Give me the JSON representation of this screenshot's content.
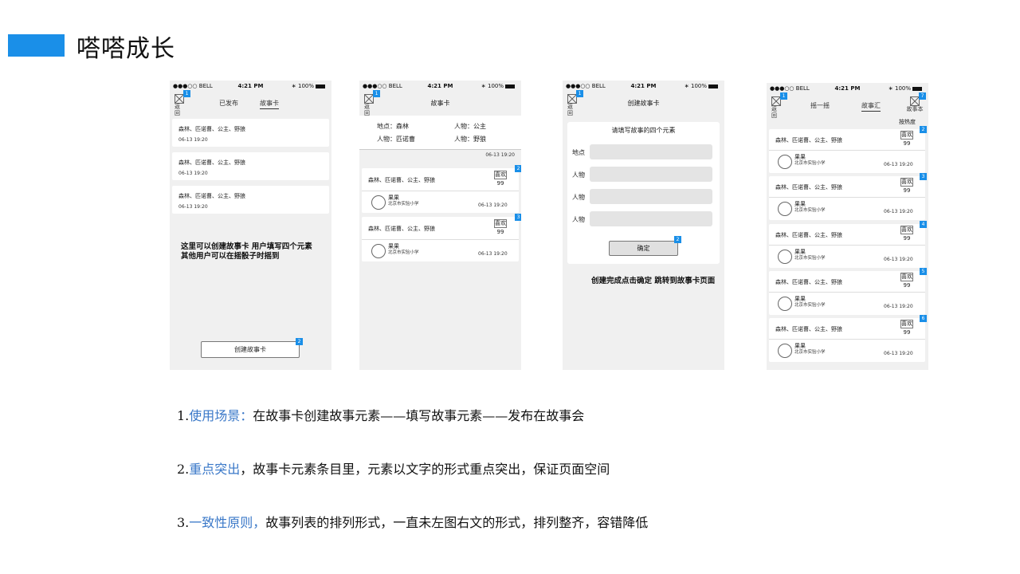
{
  "slide": {
    "title": "嗒嗒成长"
  },
  "status_bar": {
    "carrier": "●●●○○ BELL",
    "time": "4:21 PM",
    "battery": "100%"
  },
  "phone1": {
    "back_label": "返回",
    "badge_back": "1",
    "tabs": [
      "已发布",
      "故事卡"
    ],
    "cards": [
      {
        "elements": "森林、匹诺曹、公主、野狼",
        "time": "06-13  19:20"
      },
      {
        "elements": "森林、匹诺曹、公主、野狼",
        "time": "06-13  19:20"
      },
      {
        "elements": "森林、匹诺曹、公主、野狼",
        "time": "06-13  19:20"
      }
    ],
    "note_line1": "这里可以创建故事卡  用户填写四个元素",
    "note_line2": "其他用户可以在摇骰子时摇到",
    "create_button": "创建故事卡",
    "badge_create": "2"
  },
  "phone2": {
    "back_label": "返回",
    "badge_back": "1",
    "title": "故事卡",
    "detail": {
      "place": "地点：森林",
      "person1": "人物：公主",
      "person2": "人物：匹诺曹",
      "person3": "人物：野狼",
      "time": "06-13  19:20"
    },
    "posts": [
      {
        "badge": "2",
        "elements": "森林、匹诺曹、公主、野狼",
        "like_label": "喜欢",
        "like_count": "99",
        "name": "果果",
        "school": "北京市实验小学",
        "time": "06-13  19:20"
      },
      {
        "badge": "3",
        "elements": "森林、匹诺曹、公主、野狼",
        "like_label": "喜欢",
        "like_count": "99",
        "name": "果果",
        "school": "北京市实验小学",
        "time": "06-13  19:20"
      }
    ]
  },
  "phone3": {
    "back_label": "返回",
    "badge_back": "1",
    "title": "创建故事卡",
    "form_title": "请填写故事的四个元素",
    "field_labels": [
      "地点",
      "人物",
      "人物",
      "人物"
    ],
    "confirm_button": "确定",
    "badge_confirm": "2",
    "note": "创建完成点击确定 跳转到故事卡页面"
  },
  "phone4": {
    "back_label": "返回",
    "badge_back": "1",
    "badge_right": "7",
    "tabs": [
      "摇一摇",
      "故事汇"
    ],
    "right_label": "故事本",
    "sort_label": "按热度",
    "posts": [
      {
        "badge": "2",
        "elements": "森林、匹诺曹、公主、野狼",
        "like_label": "喜欢",
        "like_count": "99",
        "name": "果果",
        "school": "北京市实验小学",
        "time": "06-13  19:20"
      },
      {
        "badge": "3",
        "elements": "森林、匹诺曹、公主、野狼",
        "like_label": "喜欢",
        "like_count": "99",
        "name": "果果",
        "school": "北京市实验小学",
        "time": "06-13  19:20"
      },
      {
        "badge": "4",
        "elements": "森林、匹诺曹、公主、野狼",
        "like_label": "喜欢",
        "like_count": "99",
        "name": "果果",
        "school": "北京市实验小学",
        "time": "06-13  19:20"
      },
      {
        "badge": "5",
        "elements": "森林、匹诺曹、公主、野狼",
        "like_label": "喜欢",
        "like_count": "99",
        "name": "果果",
        "school": "北京市实验小学",
        "time": "06-13  19:20"
      },
      {
        "badge": "6",
        "elements": "森林、匹诺曹、公主、野狼",
        "like_label": "喜欢",
        "like_count": "99",
        "name": "果果",
        "school": "北京市实验小学",
        "time": "06-13  19:20"
      }
    ]
  },
  "bullets": [
    {
      "num": "1.",
      "highlight": "使用场景：",
      "text": "在故事卡创建故事元素——填写故事元素——发布在故事会"
    },
    {
      "num": "2.",
      "highlight": "重点突出",
      "text": "，故事卡元素条目里，元素以文字的形式重点突出，保证页面空间"
    },
    {
      "num": "3.",
      "highlight": "一致性原则，",
      "text": "故事列表的排列形式，一直未左图右文的形式，排列整齐，容错降低"
    }
  ],
  "colors": {
    "accent": "#1a8fe8",
    "highlight_text": "#3a78c8",
    "phone_bg": "#f0f0f0",
    "input_bg": "#e4e4e4"
  }
}
